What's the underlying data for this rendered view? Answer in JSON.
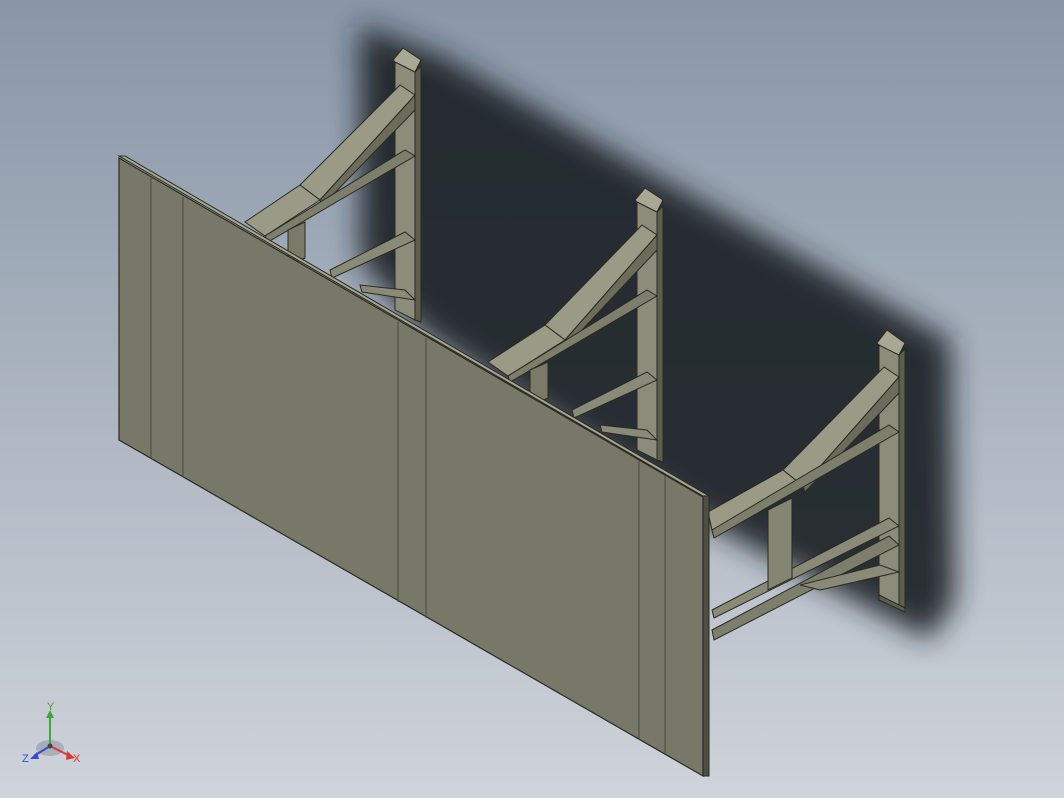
{
  "viewport": {
    "background_top": "#8a97a8",
    "background_bottom": "#cbd0d8",
    "part_color": "#7a7a6a",
    "part_light": "#9a9a88",
    "part_dark": "#4a4a3e",
    "shadow_color": "#23272d",
    "edge_color": "#2a2a22"
  },
  "triad": {
    "x_label": "X",
    "y_label": "Y",
    "z_label": "Z",
    "x_color": "#d63a3a",
    "y_color": "#3aa83a",
    "z_color": "#3a4ad6"
  }
}
